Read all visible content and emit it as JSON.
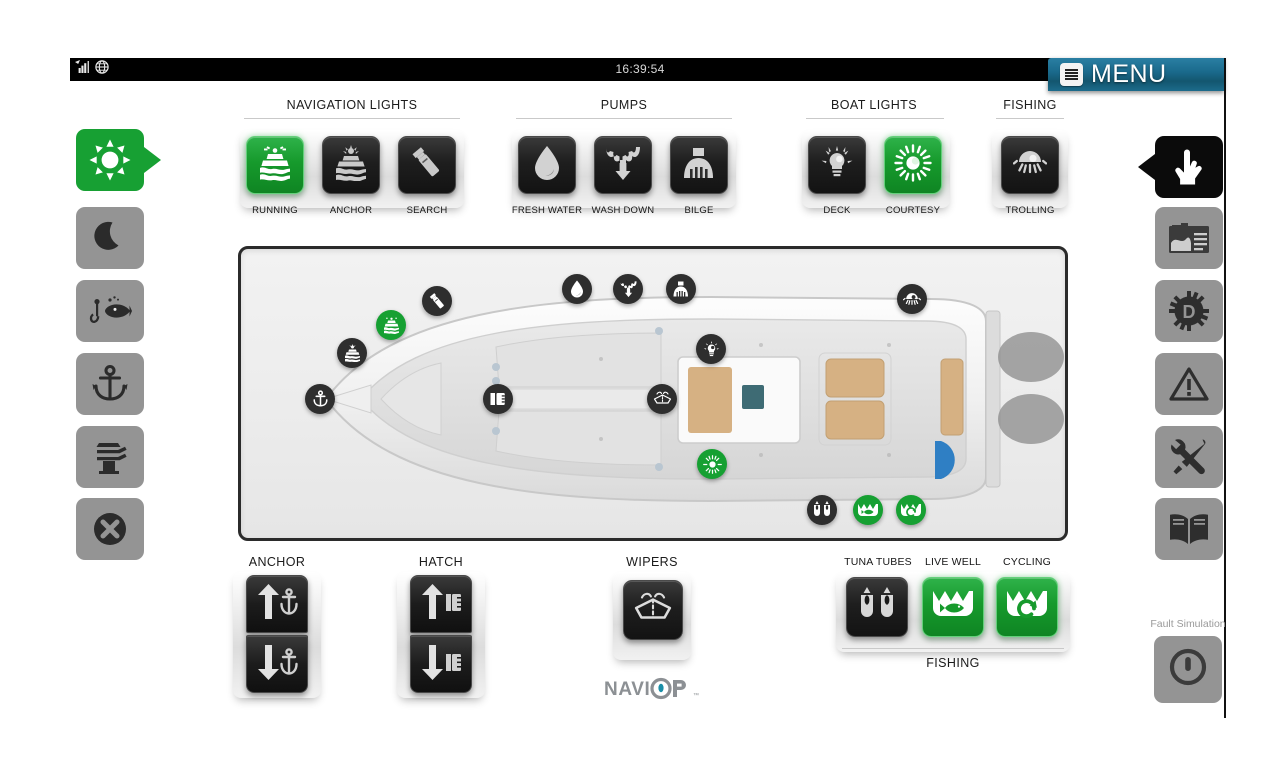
{
  "statusbar": {
    "time": "16:39:54",
    "signal_icon": "signal-bars-icon",
    "network_icon": "globe-icon"
  },
  "menu": {
    "label": "MENU",
    "icon": "hamburger-menu-icon",
    "color": "#1a6a8c"
  },
  "theme": {
    "green_on": "#169a2c",
    "button_dark": "#1e1e1e",
    "rail_grey": "#949494",
    "menu_blue": "#1a6a8c"
  },
  "left_rail": {
    "items": [
      {
        "name": "day-mode",
        "icon": "sun-icon",
        "state": "on",
        "active": true
      },
      {
        "name": "night-mode",
        "icon": "moon-icon",
        "state": "off",
        "active": false
      },
      {
        "name": "fishing-mode",
        "icon": "fish-hook-icon",
        "state": "off",
        "active": false
      },
      {
        "name": "anchor-mode",
        "icon": "anchor-icon",
        "state": "off",
        "active": false
      },
      {
        "name": "docking-mode",
        "icon": "bollard-cleat-icon",
        "state": "off",
        "active": false
      },
      {
        "name": "all-off",
        "icon": "x-circle-icon",
        "state": "off",
        "active": false
      }
    ]
  },
  "right_rail": {
    "items": [
      {
        "name": "manual-control",
        "icon": "hand-pointer-icon",
        "active": true
      },
      {
        "name": "gauges",
        "icon": "instrument-panel-icon",
        "active": false
      },
      {
        "name": "diagnostics",
        "icon": "gear-d-icon",
        "active": false
      },
      {
        "name": "alarms",
        "icon": "warning-triangle-icon",
        "active": false
      },
      {
        "name": "settings",
        "icon": "wrench-screwdriver-icon",
        "active": false
      },
      {
        "name": "manual-book",
        "icon": "open-book-icon",
        "active": false
      }
    ]
  },
  "groups": [
    {
      "title": "NAVIGATION LIGHTS",
      "buttons": [
        {
          "label": "RUNNING",
          "icon": "running-lights-icon",
          "on": true
        },
        {
          "label": "ANCHOR",
          "icon": "anchor-light-icon",
          "on": false
        },
        {
          "label": "SEARCH",
          "icon": "flashlight-icon",
          "on": false
        }
      ]
    },
    {
      "title": "PUMPS",
      "buttons": [
        {
          "label": "FRESH WATER",
          "icon": "water-drop-icon",
          "on": false
        },
        {
          "label": "WASH DOWN",
          "icon": "wash-down-icon",
          "on": false
        },
        {
          "label": "BILGE",
          "icon": "bilge-pump-icon",
          "on": false
        }
      ]
    },
    {
      "title": "BOAT LIGHTS",
      "buttons": [
        {
          "label": "DECK",
          "icon": "deck-light-bulb-icon",
          "on": false
        },
        {
          "label": "COURTESY",
          "icon": "courtesy-light-icon",
          "on": true
        }
      ]
    },
    {
      "title": "FISHING",
      "buttons": [
        {
          "label": "TROLLING",
          "icon": "trolling-light-icon",
          "on": false
        }
      ]
    }
  ],
  "bottom": {
    "anchor": {
      "title": "ANCHOR",
      "up_icon": "arrow-up-anchor-icon",
      "down_icon": "arrow-down-anchor-icon"
    },
    "hatch": {
      "title": "HATCH",
      "up_icon": "arrow-up-hatch-icon",
      "down_icon": "arrow-down-hatch-icon"
    },
    "wipers": {
      "title": "WIPERS",
      "icon": "windshield-wiper-icon",
      "on": false
    },
    "fishing": {
      "footer": "FISHING",
      "buttons": [
        {
          "label": "TUNA TUBES",
          "icon": "tuna-tubes-icon",
          "on": false
        },
        {
          "label": "LIVE WELL",
          "icon": "live-well-fish-icon",
          "on": true
        },
        {
          "label": "CYCLING",
          "icon": "live-well-cycling-icon",
          "on": true
        }
      ]
    }
  },
  "stage": {
    "vessel_icon": "boat-top-view",
    "badges": [
      {
        "name": "badge-anchor",
        "icon": "anchor-icon",
        "on": false
      },
      {
        "name": "badge-anchor-light",
        "icon": "anchor-light-icon",
        "on": false
      },
      {
        "name": "badge-running-light",
        "icon": "running-lights-icon",
        "on": true
      },
      {
        "name": "badge-search-light",
        "icon": "flashlight-icon",
        "on": false
      },
      {
        "name": "badge-hatch",
        "icon": "hatch-icon",
        "on": false
      },
      {
        "name": "badge-fresh-water",
        "icon": "water-drop-icon",
        "on": false
      },
      {
        "name": "badge-wash-down",
        "icon": "wash-down-icon",
        "on": false
      },
      {
        "name": "badge-bilge",
        "icon": "bilge-pump-icon",
        "on": false
      },
      {
        "name": "badge-trolling",
        "icon": "trolling-light-icon",
        "on": false
      },
      {
        "name": "badge-deck-light",
        "icon": "deck-light-bulb-icon",
        "on": false
      },
      {
        "name": "badge-wipers",
        "icon": "windshield-wiper-icon",
        "on": false
      },
      {
        "name": "badge-courtesy",
        "icon": "courtesy-light-icon",
        "on": true
      },
      {
        "name": "badge-tuna-tubes",
        "icon": "tuna-tubes-icon",
        "on": false
      },
      {
        "name": "badge-live-well",
        "icon": "live-well-fish-icon",
        "on": true
      },
      {
        "name": "badge-cycling",
        "icon": "live-well-cycling-icon",
        "on": true
      }
    ]
  },
  "logo": {
    "text": "NAVIOP",
    "dot_color": "#1c8fa8"
  },
  "fault": {
    "label": "Fault Simulation",
    "icon": "power-button-icon"
  }
}
